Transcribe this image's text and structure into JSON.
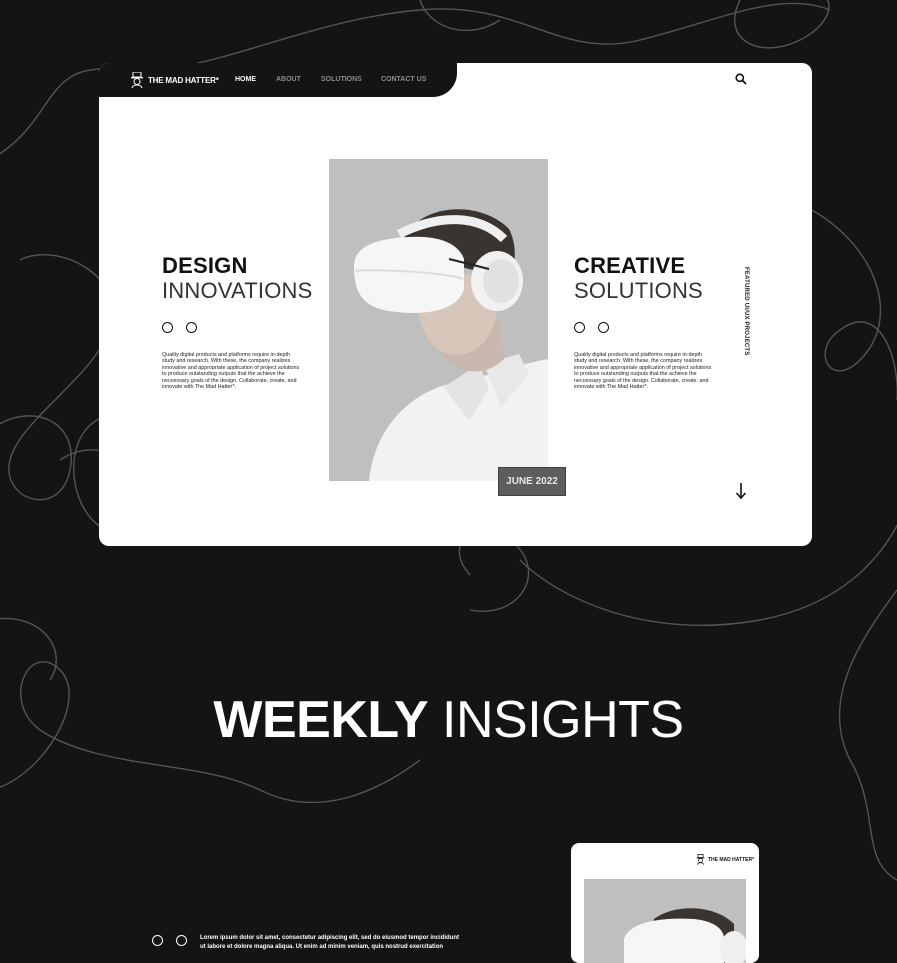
{
  "brand": {
    "name": "THE MAD HATTER*",
    "icon": "hatter-logo-icon"
  },
  "nav": {
    "items": [
      {
        "label": "HOME",
        "active": true
      },
      {
        "label": "ABOUT",
        "active": false
      },
      {
        "label": "SOLUTIONS",
        "active": false
      },
      {
        "label": "CONTACT US",
        "active": false
      }
    ],
    "search_icon": "search-icon"
  },
  "hero": {
    "left": {
      "title_bold": "DESIGN",
      "title_light": "INNOVATIONS",
      "text": "Quality digital products and platforms require in-depth study and research. With these, the company realizes innovative and appropriate application of project solutions to produce outstanding outputs that the achieve the neccessary goals of the design. Collaborate, create, and innovate with The Mad Hatter*."
    },
    "right": {
      "title_bold": "CREATIVE",
      "title_light": "SOLUTIONS",
      "text": "Quality digital products and platforms require in-depth study and research. With these, the company realizes innovative and appropriate application of project solutions to produce outstanding outputs that the achieve the neccessary goals of the design. Collaborate, create, and innovate with The Mad Hatter*."
    },
    "date_badge": "JUNE 2022",
    "vertical_label": "FEATURED UI/UX PROJECTS",
    "scroll_icon": "arrow-down-icon",
    "image_icon": "vr-headset-man-photo"
  },
  "insights": {
    "title_bold": "WEEKLY",
    "title_light": "INSIGHTS",
    "text": "Lorem ipsum dolor sit amet, consectetur adipiscing elit, sed do eiusmod tempor incididunt ut labore et dolore magna aliqua. Ut enim ad minim veniam, quis nostrud exercitation"
  },
  "mini_card": {
    "brand": "THE MAD HATTER*"
  },
  "colors": {
    "background": "#141414",
    "card": "#ffffff",
    "photo_bg": "#bfbfbf",
    "badge": "#5d5d5d"
  }
}
